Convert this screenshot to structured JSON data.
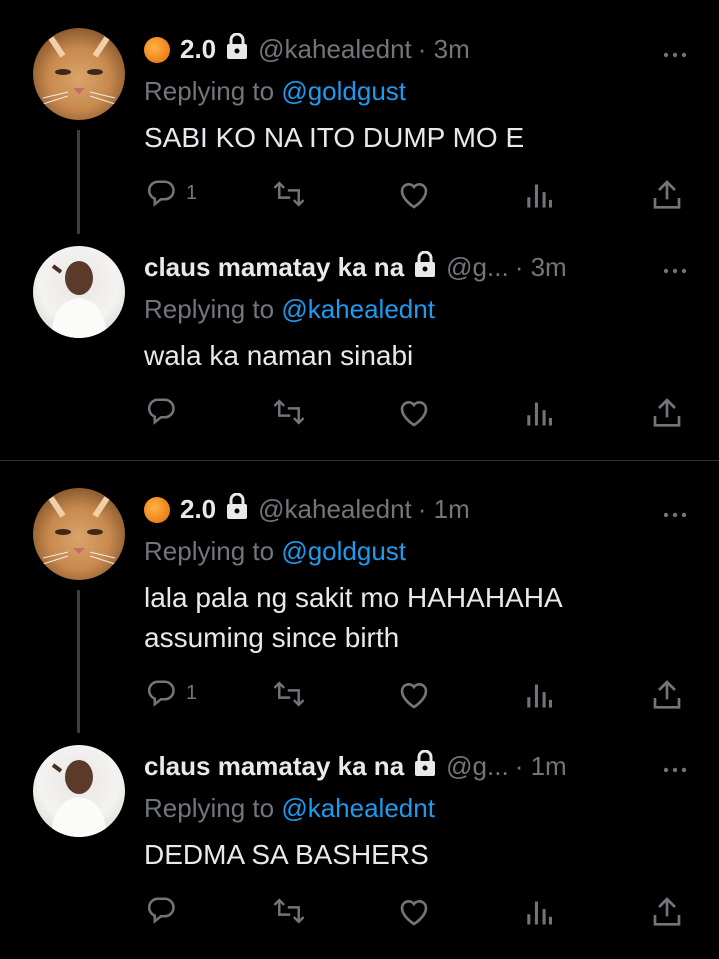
{
  "tweets": [
    {
      "avatar": "cat-avatar",
      "has_emoji": true,
      "name": "2.0",
      "handle": "@kahealednt",
      "time": "· 3m",
      "replying_prefix": "Replying to ",
      "replying_to": "@goldgust",
      "lines": [
        "SABI KO NA ITO DUMP MO E"
      ],
      "reply_count": "1"
    },
    {
      "avatar": "person-avatar",
      "has_emoji": false,
      "name": "claus mamatay ka na",
      "handle": "@g...",
      "time": "· 3m",
      "replying_prefix": "Replying to ",
      "replying_to": "@kahealednt",
      "lines": [
        "wala ka naman sinabi"
      ],
      "reply_count": ""
    },
    {
      "avatar": "cat-avatar",
      "has_emoji": true,
      "name": "2.0",
      "handle": "@kahealednt",
      "time": "· 1m",
      "replying_prefix": "Replying to ",
      "replying_to": "@goldgust",
      "lines": [
        "lala pala ng sakit mo HAHAHAHA",
        "assuming since birth"
      ],
      "reply_count": "1"
    },
    {
      "avatar": "person-avatar",
      "has_emoji": false,
      "name": "claus mamatay ka na",
      "handle": "@g...",
      "time": "· 1m",
      "replying_prefix": "Replying to ",
      "replying_to": "@kahealednt",
      "lines": [
        "DEDMA SA BASHERS"
      ],
      "reply_count": ""
    }
  ],
  "icons": {
    "reply": "reply-icon",
    "retweet": "retweet-icon",
    "like": "heart-icon",
    "views": "views-icon",
    "share": "share-icon",
    "more": "more-icon",
    "lock": "lock-icon"
  },
  "colors": {
    "background": "#000000",
    "text": "#e7e9ea",
    "secondary": "#71767b",
    "mention": "#1d9bf0"
  }
}
